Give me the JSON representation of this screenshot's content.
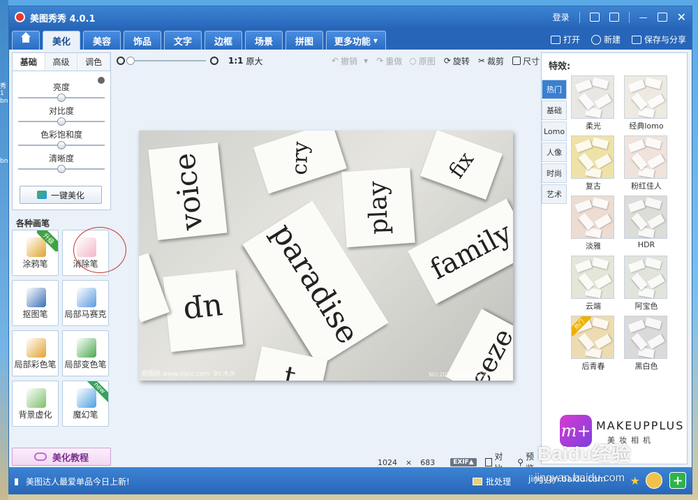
{
  "window": {
    "title": "美图秀秀 4.0.1",
    "login": "登录"
  },
  "tabs": [
    "美化",
    "美容",
    "饰品",
    "文字",
    "边框",
    "场景",
    "拼图",
    "更多功能"
  ],
  "header_actions": {
    "open": "打开",
    "new": "新建",
    "save_share": "保存与分享"
  },
  "adjust": {
    "subtabs": [
      "基础",
      "高级",
      "调色"
    ],
    "sliders": [
      {
        "label": "亮度",
        "level": 0.5
      },
      {
        "label": "对比度",
        "level": 0.5
      },
      {
        "label": "色彩饱和度",
        "level": 0.5
      },
      {
        "label": "清晰度",
        "level": 0.5
      }
    ],
    "one_click": "一键美化"
  },
  "brushes": {
    "title": "各种画笔",
    "items": [
      {
        "label": "涂鸦笔",
        "badge": "升级",
        "color": "#e0a32a"
      },
      {
        "label": "消除笔",
        "badge": "",
        "color": "#f2b8c6"
      },
      {
        "label": "抠图笔",
        "badge": "",
        "color": "#3a6fb6"
      },
      {
        "label": "局部马赛克",
        "badge": "",
        "color": "#5a9be0"
      },
      {
        "label": "局部彩色笔",
        "badge": "",
        "color": "#e3a030"
      },
      {
        "label": "局部变色笔",
        "badge": "",
        "color": "#49a84c"
      },
      {
        "label": "背景虚化",
        "badge": "",
        "color": "#7cbf6a"
      },
      {
        "label": "魔幻笔",
        "badge": "new",
        "color": "#4a9fe0"
      }
    ],
    "tutorial": "美化教程"
  },
  "toolbar": {
    "ratio": "1:1",
    "original_size": "原大",
    "undo": "撤销",
    "redo": "重做",
    "restore": "原图",
    "rotate": "旋转",
    "crop": "裁剪",
    "resize": "尺寸"
  },
  "canvas": {
    "words": [
      "voice",
      "cry",
      "fix",
      "play",
      "paradise",
      "family",
      "up",
      "eeze",
      "t"
    ],
    "watermark_left": "昵图网 www.nipic.com",
    "watermark_right": "BY:木水",
    "watermark_id": "NO:20130521091220287311"
  },
  "image_info": {
    "width": "1024",
    "times": "×",
    "height": "683",
    "exif": "EXIF▲",
    "compare": "对比",
    "preview": "预览"
  },
  "effects": {
    "title": "特效:",
    "categories": [
      "热门",
      "基础",
      "Lomo",
      "人像",
      "时尚",
      "艺术"
    ],
    "items": [
      {
        "label": "柔光",
        "tint": "#e9e7e3"
      },
      {
        "label": "经典lomo",
        "tint": "#eeeae2"
      },
      {
        "label": "复古",
        "tint": "#efe2a8"
      },
      {
        "label": "粉红佳人",
        "tint": "#efe3dc"
      },
      {
        "label": "淡雅",
        "tint": "#ecdcd2"
      },
      {
        "label": "HDR",
        "tint": "#dcdcd8"
      },
      {
        "label": "云端",
        "tint": "#e3e6d8"
      },
      {
        "label": "阿宝色",
        "tint": "#e1e3dd"
      },
      {
        "label": "后青春",
        "tint": "#eddcb2"
      },
      {
        "label": "黑白色",
        "tint": "#dadada"
      }
    ],
    "hot_ribbon": "热门",
    "thumb_word": "paradise"
  },
  "banner": {
    "logo": "m+",
    "name": "MAKEUPPLUS",
    "sub": "美妆相机"
  },
  "bottom": {
    "news": "美图达人最爱单品今日上新!",
    "batch": "批处理",
    "link": "jingyan.baidu.com"
  },
  "watermark": {
    "baidu": "Baidu经验",
    "baidu_url": "jingyan.baidu.com"
  },
  "desktop_icons": [
    "秀1",
    "bn",
    "bn"
  ]
}
